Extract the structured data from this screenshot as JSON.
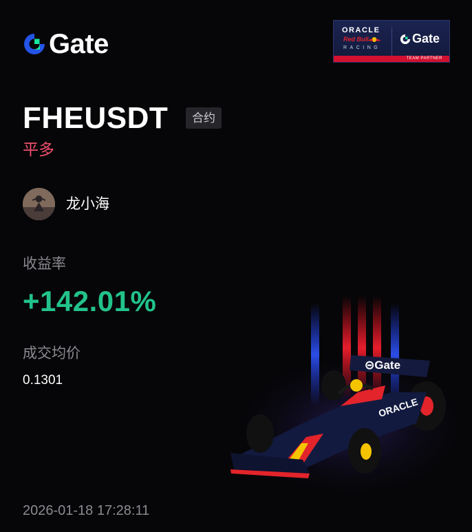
{
  "brand": {
    "name": "Gate"
  },
  "partner_badge": {
    "oracle": "ORACLE",
    "red_bull": "Red Bull",
    "racing": "RACING",
    "gate": "Gate",
    "caption": "TEAM PARTNER"
  },
  "trade": {
    "pair": "FHEUSDT",
    "type_tag": "合约",
    "side": "平多",
    "side_color": "#f0506e"
  },
  "user": {
    "name": "龙小海"
  },
  "stats": {
    "roi_label": "收益率",
    "roi_value": "+142.01%",
    "roi_color": "#22c38a",
    "avg_price_label": "成交均价",
    "avg_price_value": "0.1301"
  },
  "timestamp": "2026-01-18 17:28:11",
  "colors": {
    "background": "#060608",
    "brand_blue": "#2354e6",
    "brand_green": "#17e6a1"
  },
  "icons": [
    "gate-logo-icon",
    "redbull-bulls-icon",
    "f1-car-image"
  ]
}
